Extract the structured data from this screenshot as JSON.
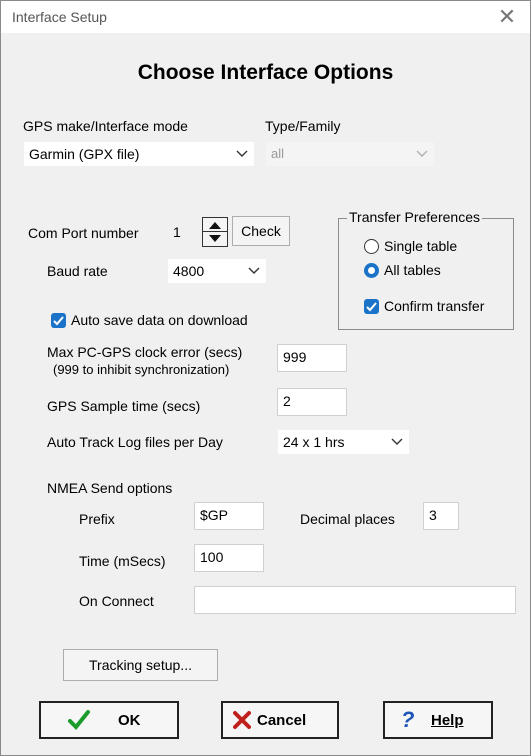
{
  "window": {
    "title": "Interface Setup",
    "close_glyph": "✕"
  },
  "heading": "Choose Interface Options",
  "gps_mode": {
    "label": "GPS make/Interface mode",
    "value": "Garmin (GPX file)"
  },
  "type_family": {
    "label": "Type/Family",
    "value": "all"
  },
  "com_port": {
    "label": "Com Port number",
    "value": "1",
    "check_label": "Check"
  },
  "baud": {
    "label": "Baud rate",
    "value": "4800"
  },
  "auto_save": {
    "label": "Auto save data on download",
    "checked": true
  },
  "transfer": {
    "title": "Transfer Preferences",
    "single_label": "Single table",
    "all_label": "All tables",
    "selected": "All tables",
    "confirm_label": "Confirm transfer",
    "confirm_checked": true
  },
  "clock_error": {
    "label_line1": "Max PC-GPS clock error (secs)",
    "label_line2": "(999 to inhibit synchronization)",
    "value": "999"
  },
  "sample_time": {
    "label": "GPS Sample time (secs)",
    "value": "2"
  },
  "track_log": {
    "label": "Auto Track Log files per Day",
    "value": "24 x 1 hrs"
  },
  "nmea": {
    "title": "NMEA  Send options",
    "prefix_label": "Prefix",
    "prefix_value": "$GP",
    "decimal_label": "Decimal places",
    "decimal_value": "3",
    "time_label": "Time (mSecs)",
    "time_value": "100",
    "on_connect_label": "On Connect",
    "on_connect_value": ""
  },
  "tracking_button": "Tracking setup...",
  "buttons": {
    "ok": "OK",
    "cancel": "Cancel",
    "help": "Help"
  },
  "colors": {
    "accent": "#1a73c8",
    "ok_check": "#1a9c2a",
    "cancel_x": "#c0201c",
    "help_q": "#1f55b8"
  }
}
